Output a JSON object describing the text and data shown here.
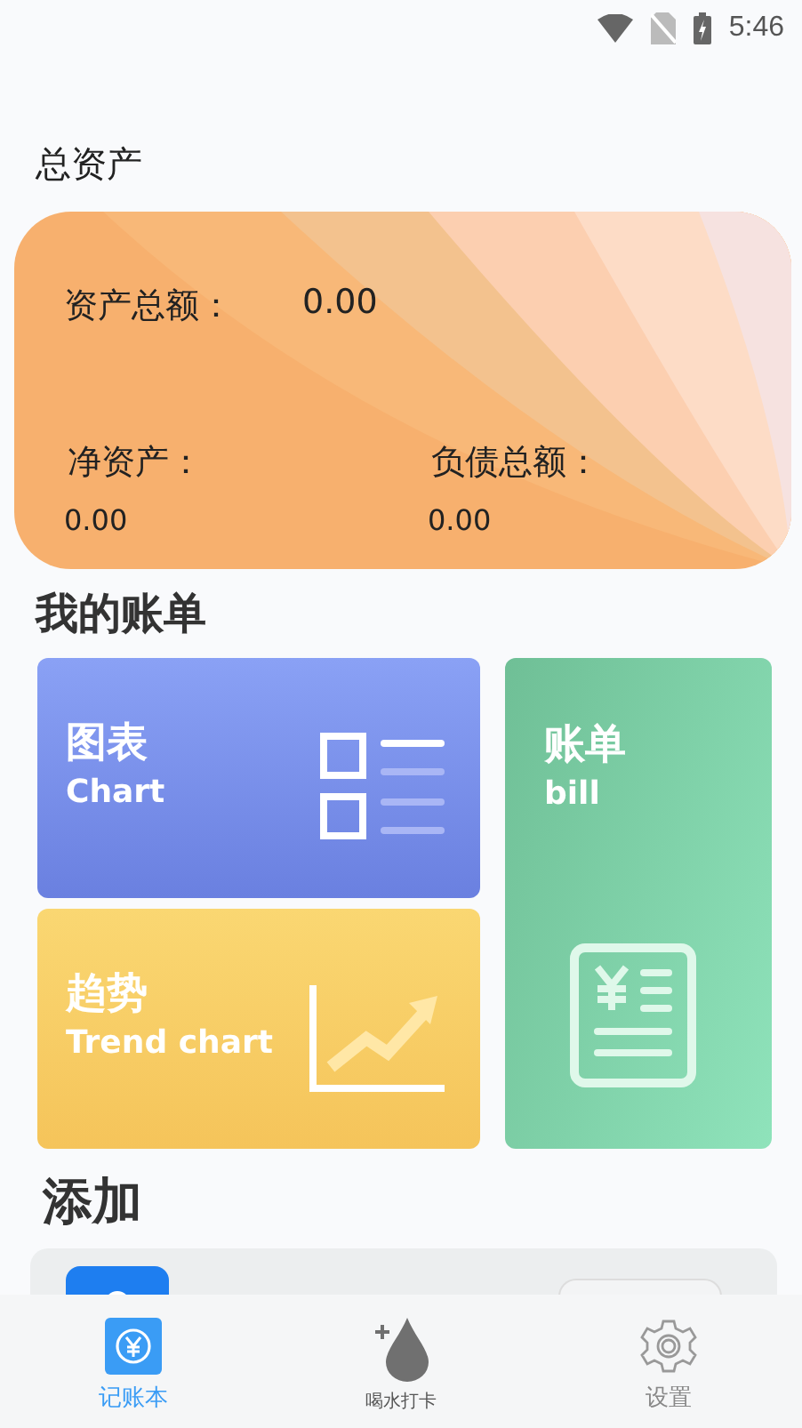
{
  "status_bar": {
    "time": "5:46"
  },
  "assets": {
    "title": "总资产",
    "total_label": "资产总额：",
    "total_value": "0.00",
    "net_label": "净资产：",
    "net_value": "0.00",
    "debt_label": "负债总额：",
    "debt_value": "0.00"
  },
  "bills": {
    "title": "我的账单",
    "tiles": [
      {
        "kind": "chart",
        "title": "图表",
        "subtitle": "Chart"
      },
      {
        "kind": "trend",
        "title": "趋势",
        "subtitle": "Trend chart"
      },
      {
        "kind": "bill",
        "title": "账单",
        "subtitle": "bill"
      }
    ]
  },
  "add": {
    "title": "添加"
  },
  "tab_bar": [
    {
      "kind": "ledger",
      "label": "记账本",
      "selected": true
    },
    {
      "kind": "water",
      "label": "喝水打卡",
      "selected": false
    },
    {
      "kind": "settings",
      "label": "设置",
      "selected": false
    }
  ]
}
